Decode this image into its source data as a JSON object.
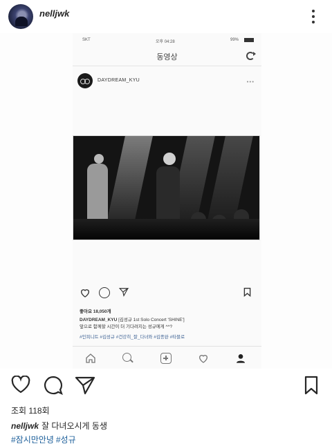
{
  "post": {
    "username": "nelljwk",
    "views": "조회 118회",
    "caption_username": "nelljwk",
    "caption_text": "잘 다녀오시게 동생",
    "hashtags": [
      "#잠시만안녕",
      "#성규"
    ]
  },
  "embedded": {
    "status": {
      "carrier": "SKT ",
      "time": "오후 04:28",
      "battery": "99%"
    },
    "nav_title": "동영상",
    "account": "DAYDREAM_KYU",
    "more": "•••",
    "likes": "좋아요 18,050개",
    "caption_user": "DAYDREAM_KYU",
    "caption_line1": "[김성규 1st Solo Concert 'SHINE']",
    "caption_line2": "앞으로 함께할 시간이 더 기다려지는 성규에게 ^^?",
    "hashtags": "#인피니트 #김성규 #건강히_잘_다녀와 #김종완 #타블로"
  },
  "icons": {
    "avatar": "avatar",
    "more": "more-icon",
    "heart": "heart-icon",
    "comment": "comment-icon",
    "share": "share-icon",
    "save": "bookmark-icon",
    "home": "home-icon",
    "search": "search-icon",
    "add": "add-icon",
    "profile": "profile-icon",
    "refresh": "refresh-icon"
  },
  "colors": {
    "hashtag": "#1a5d99",
    "text": "#262626",
    "background": "#ffffff"
  }
}
